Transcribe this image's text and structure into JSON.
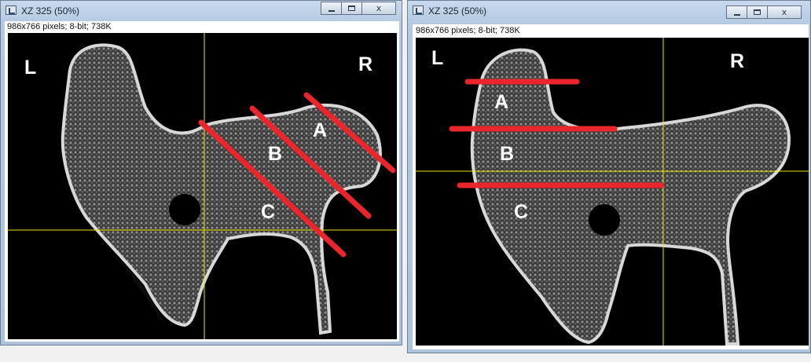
{
  "windows": [
    {
      "title": "XZ 325 (50%)",
      "info": "986x766 pixels; 8-bit; 738K",
      "labels": {
        "left": "L",
        "right": "R",
        "a": "A",
        "b": "B",
        "c": "C"
      }
    },
    {
      "title": "XZ 325 (50%)",
      "info": "986x766 pixels; 8-bit; 738K",
      "labels": {
        "left": "L",
        "right": "R",
        "a": "A",
        "b": "B",
        "c": "C"
      }
    }
  ],
  "controls": {
    "minimize": "minimize",
    "maximize": "maximize",
    "close_glyph": "x"
  },
  "colors": {
    "annotation_line": "#e8262b",
    "crosshair": "#e6e600",
    "bone": "#cfcfcf",
    "image_background": "#000000"
  },
  "icons": [
    "imagej-window-icon",
    "minimize-icon",
    "maximize-icon",
    "close-icon"
  ]
}
